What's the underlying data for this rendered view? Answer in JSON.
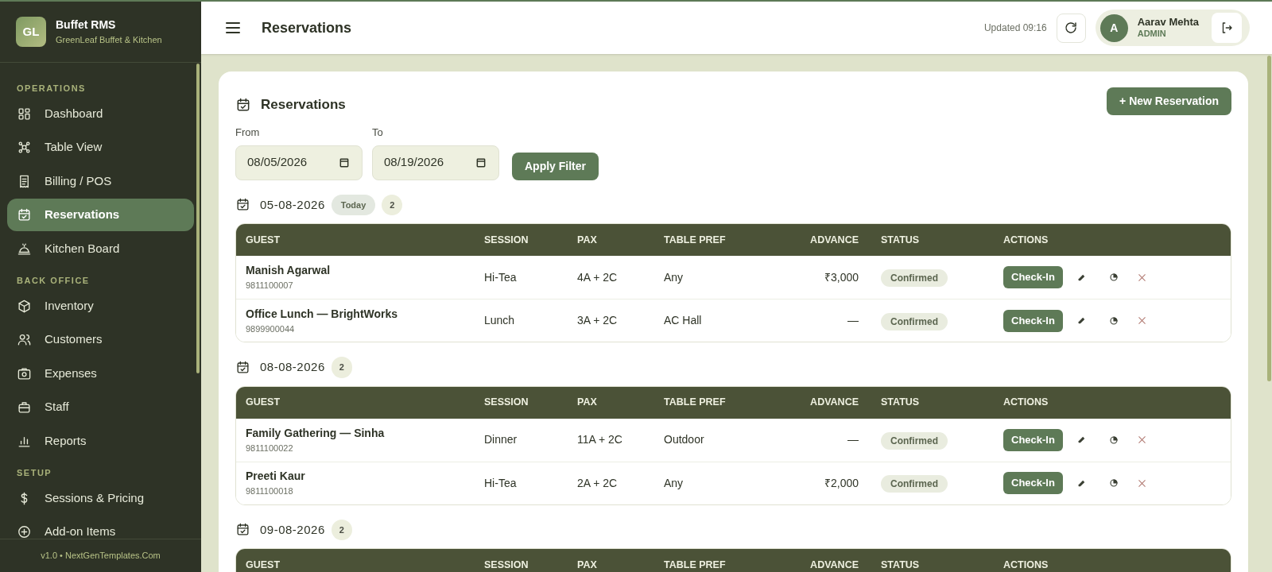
{
  "brand": {
    "logo": "GL",
    "name": "Buffet RMS",
    "subtitle": "GreenLeaf Buffet & Kitchen"
  },
  "sidebar": {
    "sections": [
      {
        "title": "OPERATIONS",
        "items": [
          {
            "label": "Dashboard",
            "selected": false
          },
          {
            "label": "Table View",
            "selected": false
          },
          {
            "label": "Billing / POS",
            "selected": false
          },
          {
            "label": "Reservations",
            "selected": true
          },
          {
            "label": "Kitchen Board",
            "selected": false
          }
        ]
      },
      {
        "title": "BACK OFFICE",
        "items": [
          {
            "label": "Inventory",
            "selected": false
          },
          {
            "label": "Customers",
            "selected": false
          },
          {
            "label": "Expenses",
            "selected": false
          },
          {
            "label": "Staff",
            "selected": false
          },
          {
            "label": "Reports",
            "selected": false
          }
        ]
      },
      {
        "title": "SETUP",
        "items": [
          {
            "label": "Sessions & Pricing",
            "selected": false
          },
          {
            "label": "Add-on Items",
            "selected": false
          }
        ]
      }
    ],
    "footer": "v1.0 • NextGenTemplates.Com"
  },
  "header": {
    "title": "Reservations",
    "updated": "Updated 09:16",
    "user": {
      "initial": "A",
      "name": "Aarav Mehta",
      "role": "ADMIN"
    }
  },
  "card": {
    "title": "Reservations",
    "new_button": "+ New Reservation",
    "filter": {
      "from_label": "From",
      "from_value": "08/05/2026",
      "to_label": "To",
      "to_value": "08/19/2026",
      "apply": "Apply Filter"
    },
    "groups": [
      {
        "date": "05-08-2026",
        "today": "Today",
        "count": "2",
        "columns": [
          "GUEST",
          "SESSION",
          "PAX",
          "TABLE PREF",
          "ADVANCE",
          "STATUS",
          "ACTIONS"
        ],
        "rows": [
          {
            "guest": "Manish Agarwal",
            "phone": "9811100007",
            "session": "Hi-Tea",
            "pax": "4A + 2C",
            "table_pref": "Any",
            "advance": "₹3,000",
            "status": "Confirmed",
            "action": "Check-In"
          },
          {
            "guest": "Office Lunch — BrightWorks",
            "phone": "9899900044",
            "session": "Lunch",
            "pax": "3A + 2C",
            "table_pref": "AC Hall",
            "advance": "—",
            "status": "Confirmed",
            "action": "Check-In"
          }
        ]
      },
      {
        "date": "08-08-2026",
        "count": "2",
        "columns": [
          "GUEST",
          "SESSION",
          "PAX",
          "TABLE PREF",
          "ADVANCE",
          "STATUS",
          "ACTIONS"
        ],
        "rows": [
          {
            "guest": "Family Gathering — Sinha",
            "phone": "9811100022",
            "session": "Dinner",
            "pax": "11A + 2C",
            "table_pref": "Outdoor",
            "advance": "—",
            "status": "Confirmed",
            "action": "Check-In"
          },
          {
            "guest": "Preeti Kaur",
            "phone": "9811100018",
            "session": "Hi-Tea",
            "pax": "2A + 2C",
            "table_pref": "Any",
            "advance": "₹2,000",
            "status": "Confirmed",
            "action": "Check-In"
          }
        ]
      },
      {
        "date": "09-08-2026",
        "count": "2",
        "columns": [
          "GUEST",
          "SESSION",
          "PAX",
          "TABLE PREF",
          "ADVANCE",
          "STATUS",
          "ACTIONS"
        ]
      }
    ]
  }
}
